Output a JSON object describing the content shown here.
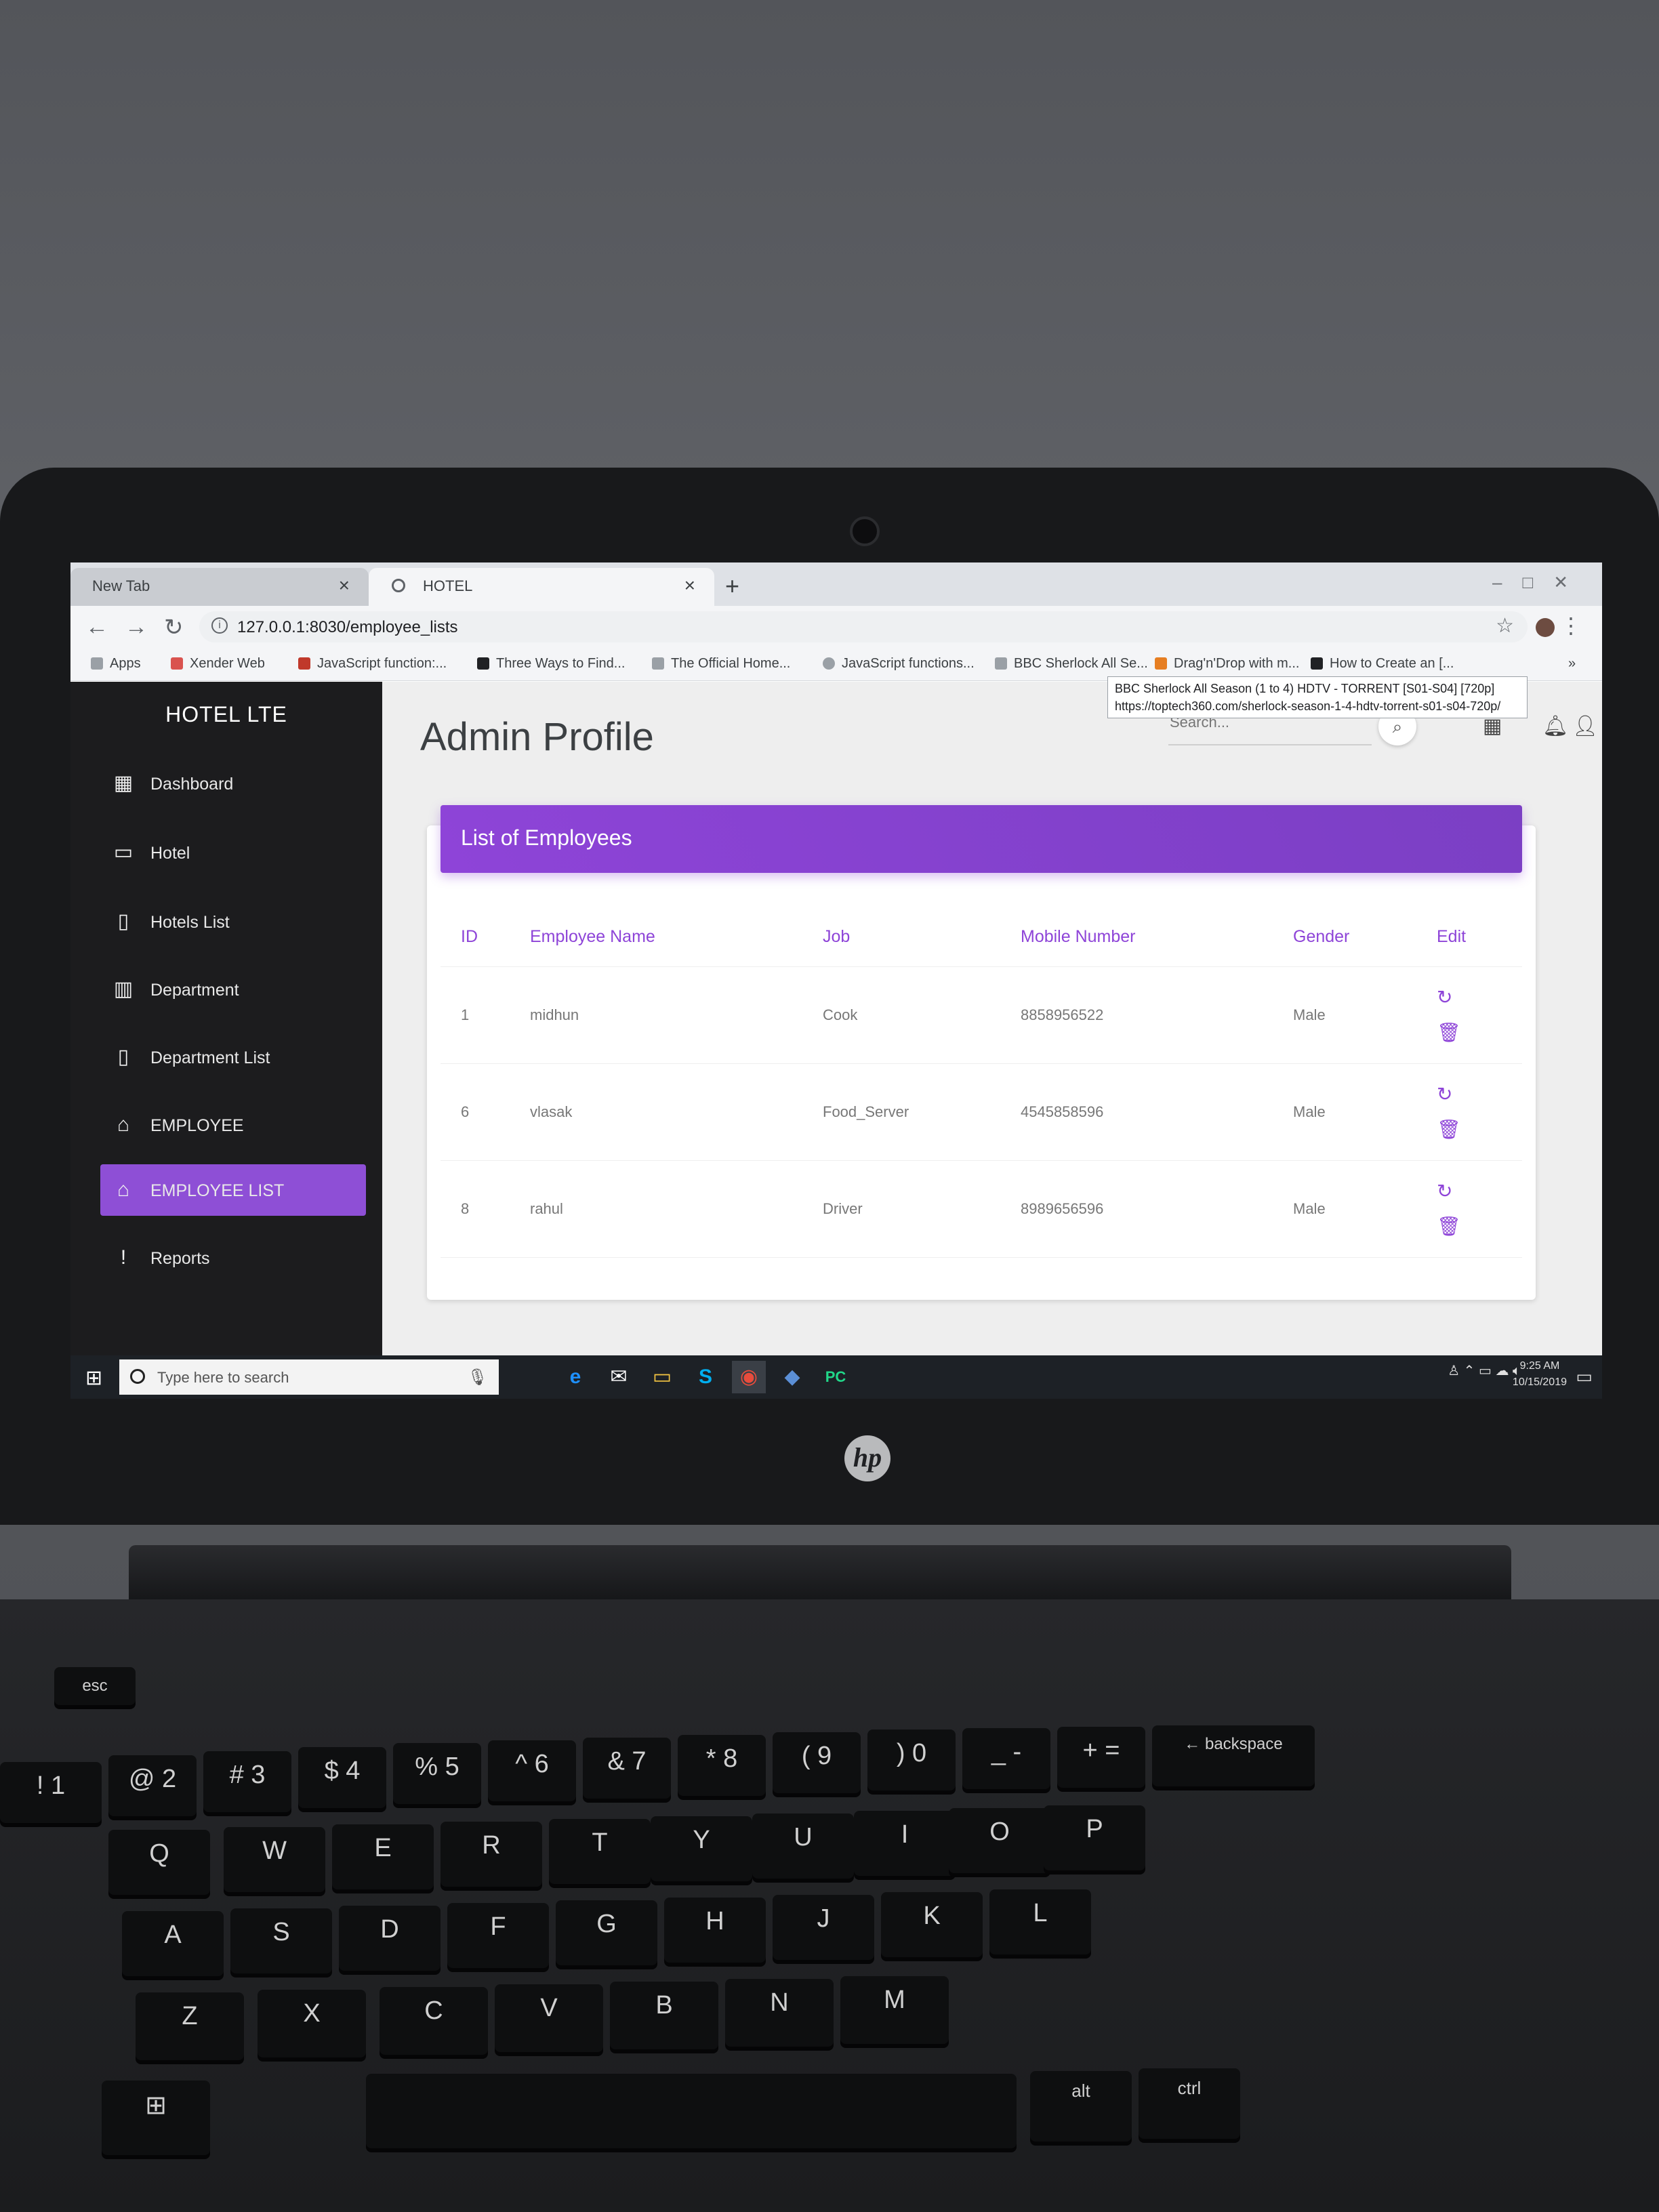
{
  "browser": {
    "tabs": [
      {
        "label": "New Tab"
      },
      {
        "label": "HOTEL"
      }
    ],
    "new_tab_symbol": "+",
    "close_symbol": "×",
    "url": "127.0.0.1:8030/employee_lists",
    "bookmarks": [
      {
        "label": "Apps",
        "icon": "apps-grid-icon"
      },
      {
        "label": "Xender Web",
        "icon": "xender-icon"
      },
      {
        "label": "JavaScript function:...",
        "icon": "bookmark-icon"
      },
      {
        "label": "Three Ways to Find...",
        "icon": "bookmark-icon"
      },
      {
        "label": "The Official Home...",
        "icon": "bookmark-icon"
      },
      {
        "label": "JavaScript functions...",
        "icon": "globe-icon"
      },
      {
        "label": "BBC Sherlock All Se...",
        "icon": "bookmark-icon"
      },
      {
        "label": "Drag'n'Drop with m...",
        "icon": "bookmark-icon"
      },
      {
        "label": "How to Create an [...",
        "icon": "bookmark-icon"
      }
    ],
    "more_bookmarks": "»",
    "tooltip": {
      "line1": "BBC Sherlock All Season (1 to 4) HDTV - TORRENT [S01-S04] [720p]",
      "line2": "https://toptech360.com/sherlock-season-1-4-hdtv-torrent-s01-s04-720p/"
    }
  },
  "sidebar": {
    "brand": "HOTEL LTE",
    "items": [
      {
        "label": "Dashboard",
        "icon": "dashboard-icon",
        "glyph": "▦"
      },
      {
        "label": "Hotel",
        "icon": "bed-icon",
        "glyph": "▭"
      },
      {
        "label": "Hotels List",
        "icon": "clipboard-icon",
        "glyph": "▯"
      },
      {
        "label": "Department",
        "icon": "bar-chart-icon",
        "glyph": "▥"
      },
      {
        "label": "Department List",
        "icon": "clipboard-icon",
        "glyph": "▯"
      },
      {
        "label": "EMPLOYEE",
        "icon": "home-icon",
        "glyph": "⌂"
      },
      {
        "label": "EMPLOYEE LIST",
        "icon": "home-icon",
        "glyph": "⌂",
        "active": true
      },
      {
        "label": "Reports",
        "icon": "alert-icon",
        "glyph": "!"
      }
    ]
  },
  "header": {
    "title": "Admin Profile",
    "search_placeholder": "Search..."
  },
  "employees": {
    "card_title": "List of Employees",
    "columns": [
      "ID",
      "Employee Name",
      "Job",
      "Mobile Number",
      "Gender",
      "Edit"
    ],
    "rows": [
      {
        "id": "1",
        "name": "midhun",
        "job": "Cook",
        "mobile": "8858956522",
        "gender": "Male"
      },
      {
        "id": "6",
        "name": "vlasak",
        "job": "Food_Server",
        "mobile": "4545858596",
        "gender": "Male"
      },
      {
        "id": "8",
        "name": "rahul",
        "job": "Driver",
        "mobile": "8989656596",
        "gender": "Male"
      }
    ]
  },
  "taskbar": {
    "search_placeholder": "Type here to search",
    "time": "9:25 AM",
    "date": "10/15/2019"
  },
  "colors": {
    "accent": "#8e44d8",
    "sidebar_bg": "#1c1c1e",
    "active_item": "#8e4fd6"
  }
}
